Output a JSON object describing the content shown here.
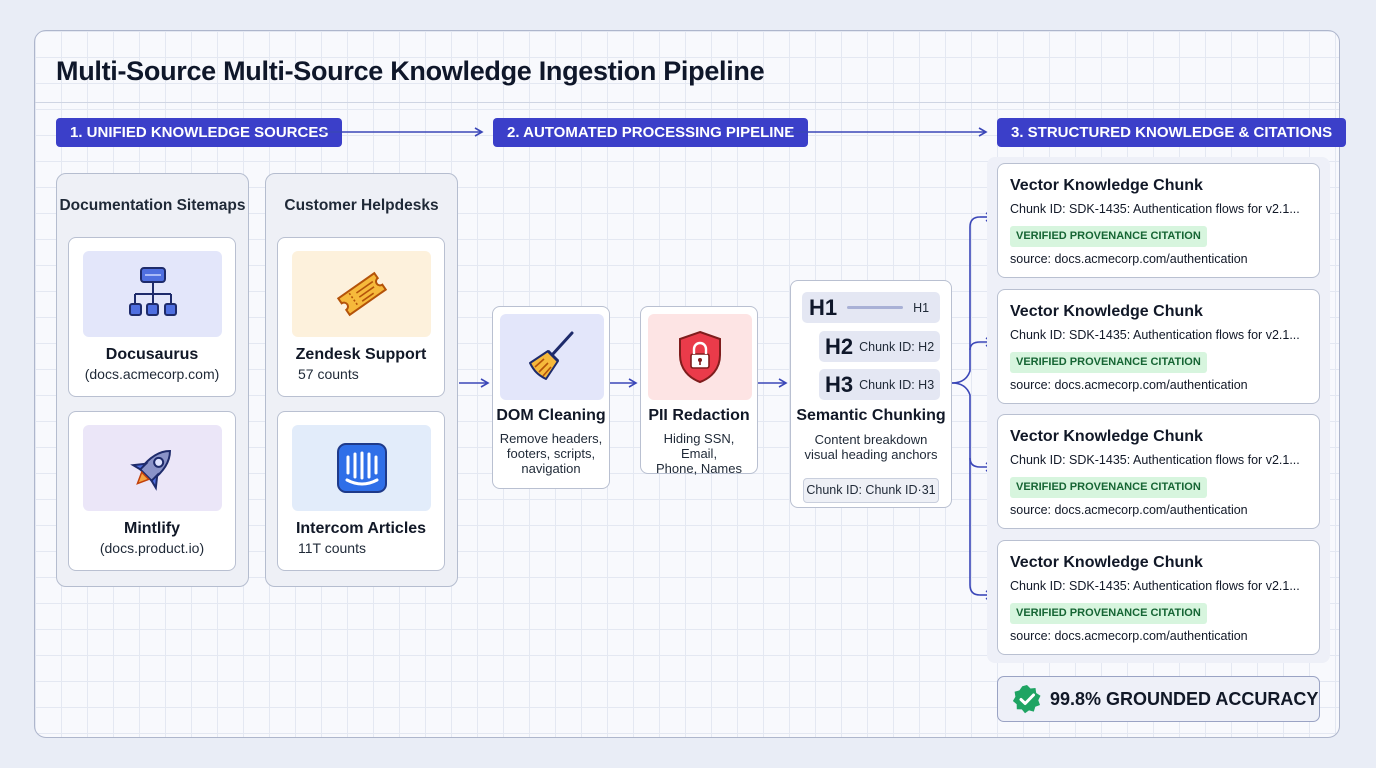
{
  "title": "Multi-Source Multi-Source Knowledge Ingestion Pipeline",
  "stages": [
    "1. UNIFIED KNOWLEDGE SOURCES",
    "2. AUTOMATED PROCESSING PIPELINE",
    "3. STRUCTURED KNOWLEDGE & CITATIONS"
  ],
  "source_groups": [
    {
      "title": "Documentation Sitemaps",
      "cards": [
        {
          "name": "Docusaurus",
          "detail": "(docs.acmecorp.com)",
          "icon": "sitemap-icon",
          "tile_color": "#e3e6fa"
        },
        {
          "name": "Mintlify",
          "detail": "(docs.product.io)",
          "icon": "rocket-icon",
          "tile_color": "#ebe6f8"
        }
      ]
    },
    {
      "title": "Customer Helpdesks",
      "cards": [
        {
          "name": "Zendesk Support",
          "detail": "57 counts",
          "icon": "ticket-icon",
          "tile_color": "#fdf1dc"
        },
        {
          "name": "Intercom Articles",
          "detail": "11T counts",
          "icon": "intercom-icon",
          "tile_color": "#e2ecfa"
        }
      ]
    }
  ],
  "processing": [
    {
      "name": "DOM Cleaning",
      "description": [
        "Remove headers,",
        "footers, scripts,",
        "navigation"
      ],
      "icon": "broom-icon",
      "tile_color": "#e3e6fa"
    },
    {
      "name": "PII Redaction",
      "description": [
        "Hiding SSN, Email,",
        "Phone, Names"
      ],
      "icon": "shield-lock-icon",
      "tile_color": "#fde4e4"
    }
  ],
  "chunking": {
    "headings": [
      {
        "tag": "H1",
        "label": "H1"
      },
      {
        "tag": "H2",
        "label": "Chunk ID: H2"
      },
      {
        "tag": "H3",
        "label": "Chunk ID: H3"
      }
    ],
    "name": "Semantic Chunking",
    "description": [
      "Content breakdown",
      "visual heading anchors"
    ],
    "chunk_id": "Chunk ID: Chunk ID·31"
  },
  "chunks": [
    {
      "title": "Vector Knowledge Chunk",
      "id": "Chunk ID: SDK-1435: Authentication flows for v2.1...",
      "badge": "VERIFIED PROVENANCE CITATION",
      "source": "source: docs.acmecorp.com/authentication"
    },
    {
      "title": "Vector Knowledge Chunk",
      "id": "Chunk ID: SDK-1435: Authentication flows for v2.1...",
      "badge": "VERIFIED PROVENANCE CITATION",
      "source": "source: docs.acmecorp.com/authentication"
    },
    {
      "title": "Vector Knowledge Chunk",
      "id": "Chunk ID: SDK-1435: Authentication flows for v2.1...",
      "badge": "VERIFIED PROVENANCE CITATION",
      "source": "source: docs.acmecorp.com/authentication"
    },
    {
      "title": "Vector Knowledge Chunk",
      "id": "Chunk ID: SDK-1435: Authentication flows for v2.1...",
      "badge": "VERIFIED PROVENANCE CITATION",
      "source": "source: docs.acmecorp.com/authentication"
    }
  ],
  "accuracy": {
    "label": "99.8% GROUNDED ACCURACY",
    "icon": "check-badge-icon"
  },
  "colors": {
    "accent": "#3b3fc9",
    "line": "#3b47b8",
    "badge_bg": "#d7f5de",
    "badge_text": "#166534",
    "check": "#1fa463"
  }
}
